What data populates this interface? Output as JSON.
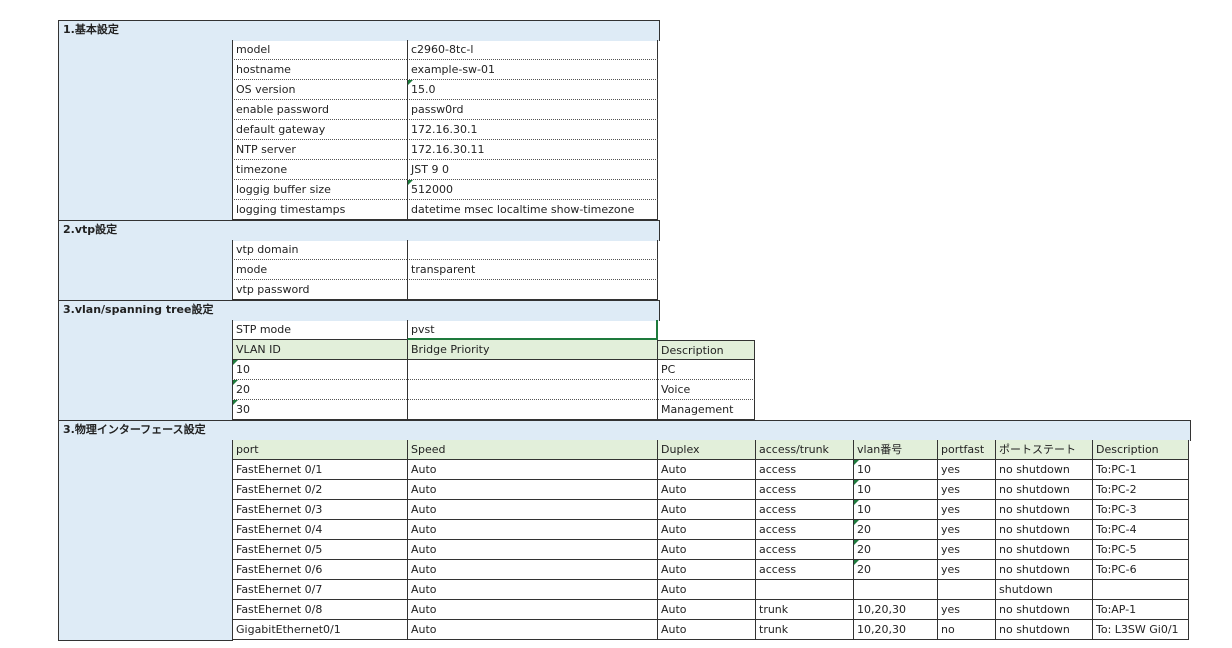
{
  "sections": {
    "s1_title": "1.基本設定",
    "s2_title": "2.vtp設定",
    "s3_title": "3.vlan/spanning tree設定",
    "s4_title": "3.物理インターフェース設定"
  },
  "basic": [
    {
      "k": "model",
      "v": "c2960-8tc-l"
    },
    {
      "k": "hostname",
      "v": "example-sw-01"
    },
    {
      "k": "OS version",
      "v": "15.0"
    },
    {
      "k": "enable password",
      "v": "passw0rd"
    },
    {
      "k": "default gateway",
      "v": "172.16.30.1"
    },
    {
      "k": "NTP server",
      "v": "172.16.30.11"
    },
    {
      "k": "timezone",
      "v": "JST 9 0"
    },
    {
      "k": "loggig buffer size",
      "v": "512000"
    },
    {
      "k": "logging timestamps",
      "v": "datetime msec localtime show-timezone"
    }
  ],
  "vtp": [
    {
      "k": "vtp domain",
      "v": ""
    },
    {
      "k": "mode",
      "v": "transparent"
    },
    {
      "k": "vtp password",
      "v": ""
    }
  ],
  "stp": {
    "mode_label": "STP mode",
    "mode_value": "pvst",
    "headers": [
      "VLAN ID",
      "Bridge Priority",
      "Description"
    ],
    "rows": [
      {
        "id": "10",
        "prio": "",
        "desc": "PC"
      },
      {
        "id": "20",
        "prio": "",
        "desc": "Voice"
      },
      {
        "id": "30",
        "prio": "",
        "desc": "Management"
      }
    ]
  },
  "ifaces": {
    "headers": [
      "port",
      "Speed",
      "Duplex",
      "access/trunk",
      "vlan番号",
      "portfast",
      "ポートステート",
      "Description"
    ],
    "rows": [
      [
        "FastEhernet 0/1",
        "Auto",
        "Auto",
        "access",
        "10",
        "yes",
        "no shutdown",
        "To:PC-1"
      ],
      [
        "FastEhernet 0/2",
        "Auto",
        "Auto",
        "access",
        "10",
        "yes",
        "no shutdown",
        "To:PC-2"
      ],
      [
        "FastEhernet 0/3",
        "Auto",
        "Auto",
        "access",
        "10",
        "yes",
        "no shutdown",
        "To:PC-3"
      ],
      [
        "FastEhernet 0/4",
        "Auto",
        "Auto",
        "access",
        "20",
        "yes",
        "no shutdown",
        "To:PC-4"
      ],
      [
        "FastEhernet 0/5",
        "Auto",
        "Auto",
        "access",
        "20",
        "yes",
        "no shutdown",
        "To:PC-5"
      ],
      [
        "FastEhernet 0/6",
        "Auto",
        "Auto",
        "access",
        "20",
        "yes",
        "no shutdown",
        "To:PC-6"
      ],
      [
        "FastEhernet 0/7",
        "Auto",
        "Auto",
        "",
        "",
        "",
        "shutdown",
        ""
      ],
      [
        "FastEhernet 0/8",
        "Auto",
        "Auto",
        "trunk",
        "10,20,30",
        "yes",
        "no shutdown",
        "To:AP-1"
      ],
      [
        "GigabitEthernet0/1",
        "Auto",
        "Auto",
        "trunk",
        "10,20,30",
        "no",
        "no shutdown",
        "To: L3SW Gi0/1"
      ]
    ]
  },
  "colors": {
    "section_bg": "#deebf6",
    "header_green": "#e2efda",
    "note_marker": "#1e7a3c"
  }
}
